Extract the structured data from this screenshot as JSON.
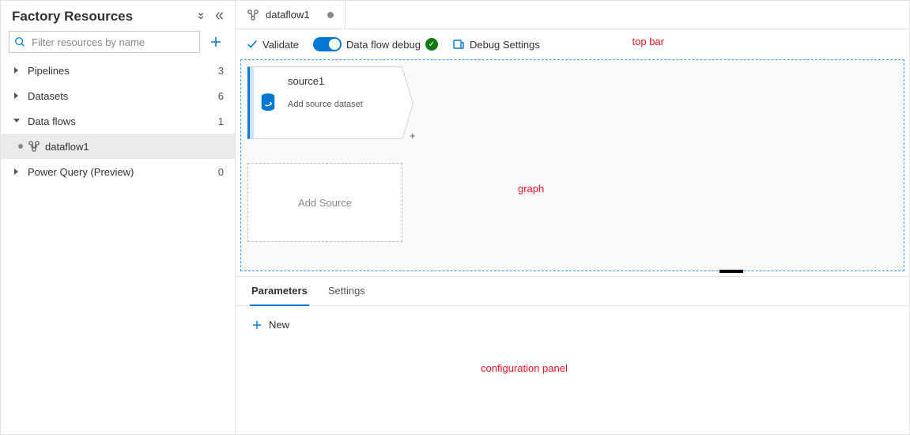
{
  "sidebar": {
    "title": "Factory Resources",
    "search_placeholder": "Filter resources by name",
    "items": [
      {
        "label": "Pipelines",
        "count": "3",
        "expanded": false
      },
      {
        "label": "Datasets",
        "count": "6",
        "expanded": false
      },
      {
        "label": "Data flows",
        "count": "1",
        "expanded": true,
        "children": [
          {
            "label": "dataflow1"
          }
        ]
      },
      {
        "label": "Power Query (Preview)",
        "count": "0",
        "expanded": false
      }
    ]
  },
  "tab": {
    "label": "dataflow1"
  },
  "actions": {
    "validate": "Validate",
    "debug_label": "Data flow debug",
    "debug_on": true,
    "debug_settings": "Debug Settings"
  },
  "annotations": {
    "top_bar": "top bar",
    "graph": "graph",
    "config_panel": "configuration panel"
  },
  "graph": {
    "source_node": {
      "title": "source1",
      "subtitle": "Add source dataset"
    },
    "add_source": "Add Source"
  },
  "config": {
    "tabs": [
      "Parameters",
      "Settings"
    ],
    "active_tab": 0,
    "new_label": "New"
  }
}
